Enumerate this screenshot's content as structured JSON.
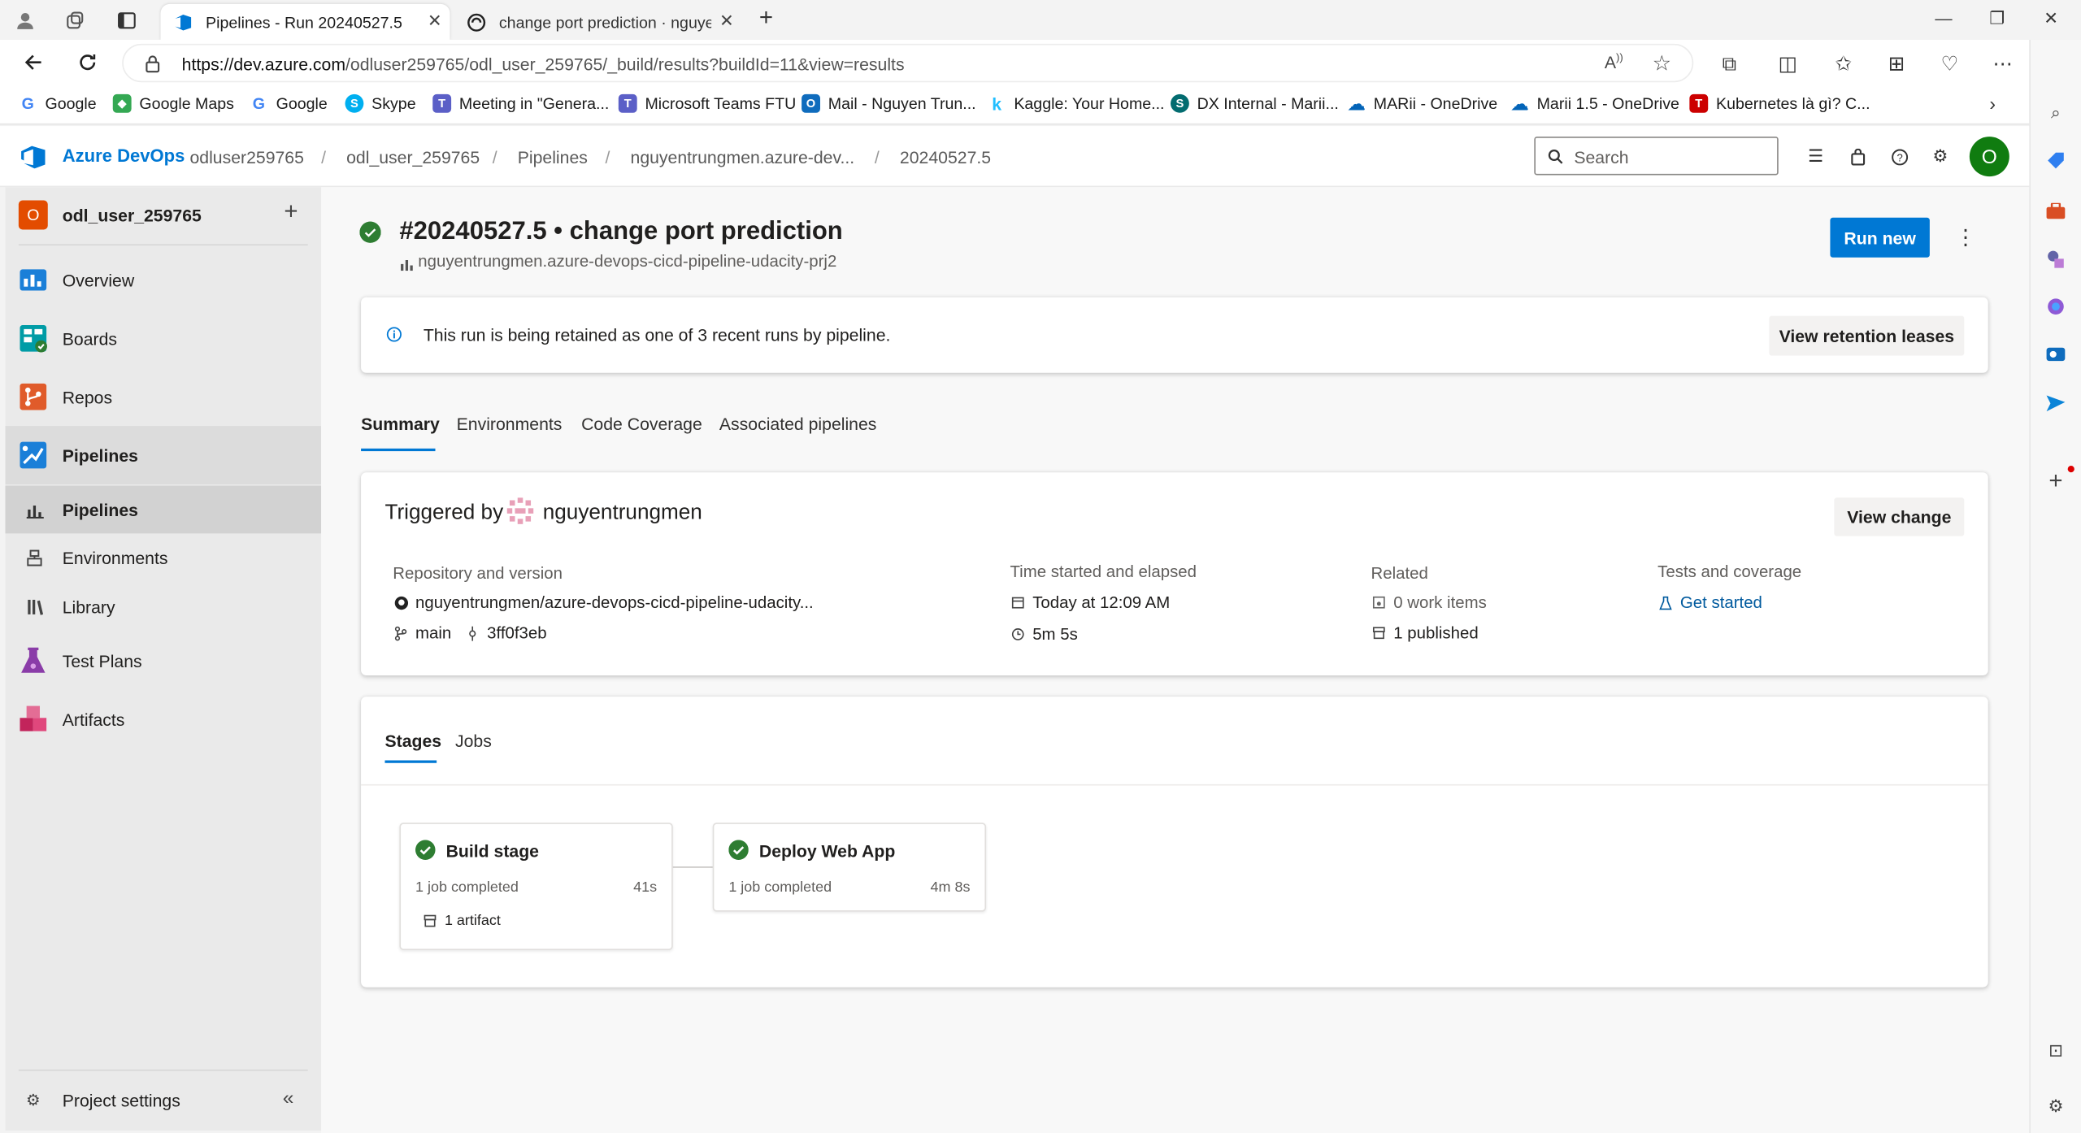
{
  "browser": {
    "tabs": [
      {
        "title": "Pipelines - Run 20240527.5",
        "active": true
      },
      {
        "title": "change port prediction · nguyent",
        "active": false
      }
    ],
    "url_host": "https://dev.azure.com",
    "url_path": "/odluser259765/odl_user_259765/_build/results?buildId=11&view=results",
    "bookmarks": [
      {
        "label": "Google",
        "icon": "google-icon"
      },
      {
        "label": "Google Maps",
        "icon": "maps-icon"
      },
      {
        "label": "Google",
        "icon": "google-icon"
      },
      {
        "label": "Skype",
        "icon": "skype-icon"
      },
      {
        "label": "Meeting in \"Genera...",
        "icon": "teams-icon"
      },
      {
        "label": "Microsoft Teams FTU",
        "icon": "teams-icon"
      },
      {
        "label": "Mail - Nguyen Trun...",
        "icon": "outlook-icon"
      },
      {
        "label": "Kaggle: Your Home...",
        "icon": "kaggle-icon"
      },
      {
        "label": "DX Internal - Marii...",
        "icon": "sharepoint-icon"
      },
      {
        "label": "MARii - OneDrive",
        "icon": "onedrive-icon"
      },
      {
        "label": "Marii 1.5 - OneDrive",
        "icon": "onedrive-icon"
      },
      {
        "label": "Kubernetes là gì? C...",
        "icon": "t-icon"
      }
    ]
  },
  "ado": {
    "brand": "Azure DevOps",
    "breadcrumb": [
      "odluser259765",
      "odl_user_259765",
      "Pipelines",
      "nguyentrungmen.azure-dev...",
      "20240527.5"
    ],
    "search_placeholder": "Search",
    "avatar_letter": "O"
  },
  "sidebar": {
    "project": "odl_user_259765",
    "project_badge": "O",
    "items": [
      {
        "label": "Overview"
      },
      {
        "label": "Boards"
      },
      {
        "label": "Repos"
      },
      {
        "label": "Pipelines"
      },
      {
        "label": "Test Plans"
      },
      {
        "label": "Artifacts"
      }
    ],
    "subitems": [
      {
        "label": "Pipelines"
      },
      {
        "label": "Environments"
      },
      {
        "label": "Library"
      }
    ],
    "settings": "Project settings"
  },
  "run": {
    "title": "#20240527.5 • change port prediction",
    "repo": "nguyentrungmen.azure-devops-cicd-pipeline-udacity-prj2",
    "run_new": "Run new",
    "retention_msg": "This run is being retained as one of 3 recent runs by pipeline.",
    "view_retention": "View retention leases",
    "tabs": [
      "Summary",
      "Environments",
      "Code Coverage",
      "Associated pipelines"
    ],
    "triggered_prefix": "Triggered by",
    "triggered_user": "nguyentrungmen",
    "view_change": "View change",
    "repo_version_label": "Repository and version",
    "repo_version": "nguyentrungmen/azure-devops-cicd-pipeline-udacity...",
    "branch": "main",
    "commit": "3ff0f3eb",
    "time_label": "Time started and elapsed",
    "started": "Today at 12:09 AM",
    "elapsed": "5m 5s",
    "related_label": "Related",
    "work_items": "0 work items",
    "published": "1 published",
    "tests_label": "Tests and coverage",
    "get_started": "Get started"
  },
  "stages_section": {
    "tabs": [
      "Stages",
      "Jobs"
    ],
    "stages": [
      {
        "name": "Build stage",
        "jobs": "1 job completed",
        "duration": "41s",
        "artifact": "1 artifact"
      },
      {
        "name": "Deploy Web App",
        "jobs": "1 job completed",
        "duration": "4m 8s"
      }
    ]
  },
  "colors": {
    "accent": "#0078d4",
    "success": "#2e7d32",
    "project_badge": "#e34c00",
    "avatar": "#107c10"
  }
}
